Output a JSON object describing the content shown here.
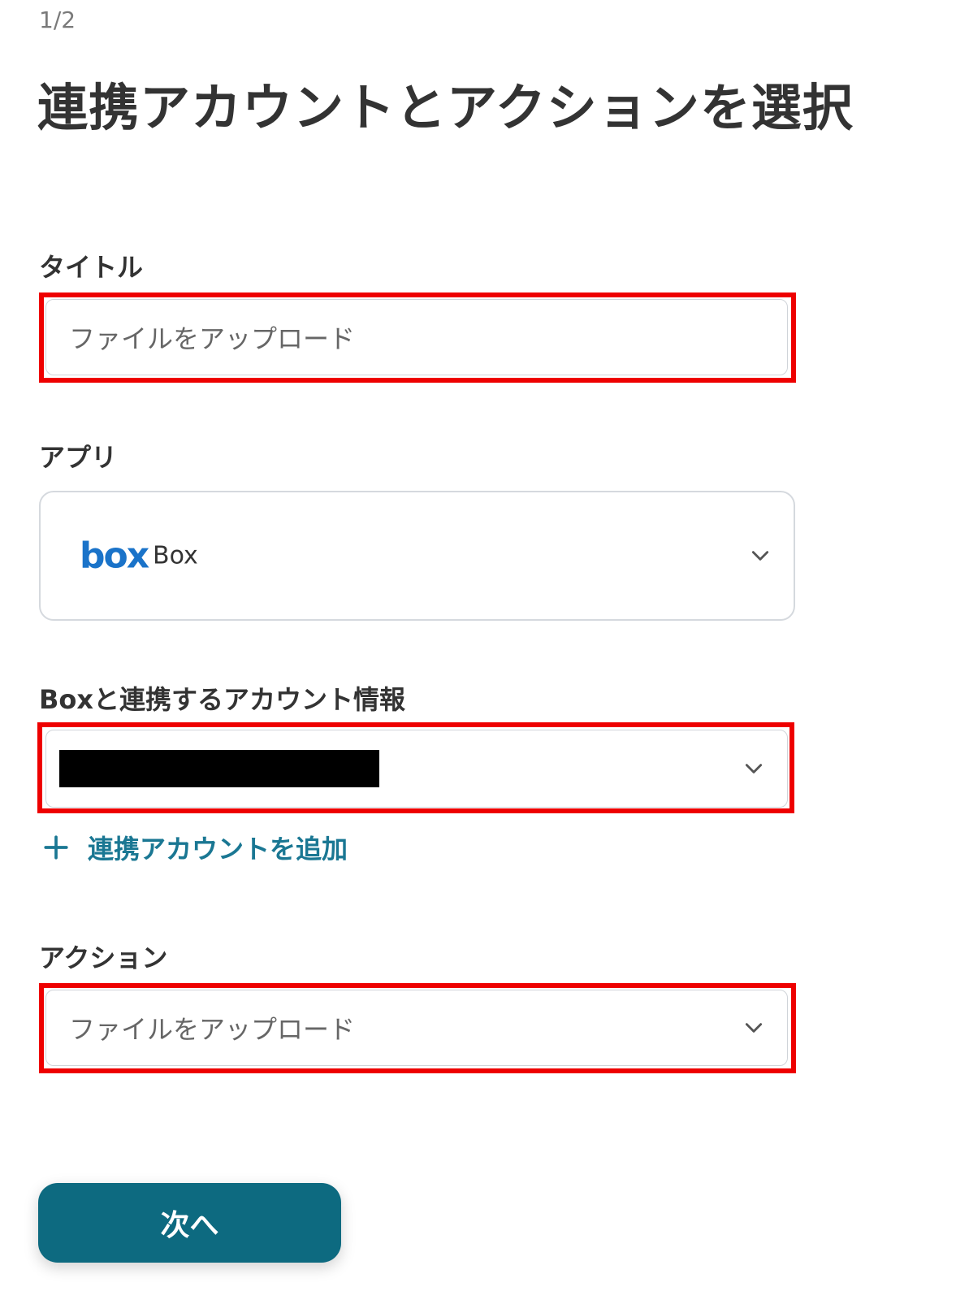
{
  "step": "1/2",
  "page_title": "連携アカウントとアクションを選択",
  "title_field": {
    "label": "タイトル",
    "value": "ファイルをアップロード"
  },
  "app_field": {
    "label": "アプリ",
    "logo_text": "box",
    "app_name": "Box"
  },
  "account_field": {
    "label": "Boxと連携するアカウント情報",
    "add_link": "連携アカウントを追加"
  },
  "action_field": {
    "label": "アクション",
    "value": "ファイルをアップロード"
  },
  "next_button": "次へ",
  "colors": {
    "highlight": "#ee0000",
    "accent": "#0d6a80",
    "link": "#1a7793",
    "box_brand": "#1a73c9"
  },
  "icons": [
    "chevron-down-icon",
    "plus-icon",
    "box-logo"
  ]
}
